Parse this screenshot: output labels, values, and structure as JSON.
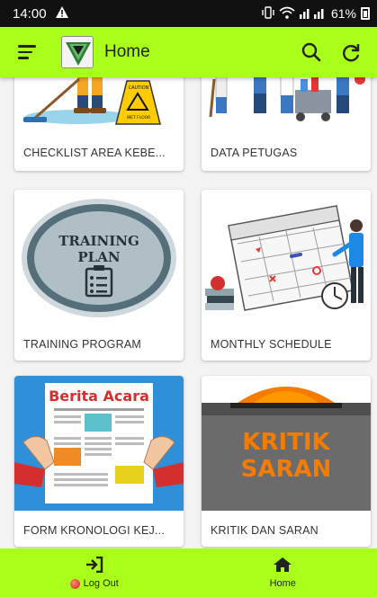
{
  "status_bar": {
    "time": "14:00",
    "battery": "61%",
    "icons": [
      "alert-icon",
      "vibrate-icon",
      "wifi-icon",
      "signal-icon",
      "battery-icon"
    ]
  },
  "app_bar": {
    "title": "Home",
    "actions": [
      "search-icon",
      "refresh-icon"
    ],
    "background": "#aaff1a"
  },
  "cards": [
    {
      "label": "CHECKLIST AREA KEBE...",
      "art": "cleaner-wet-floor"
    },
    {
      "label": "DATA PETUGAS",
      "art": "cleaning-staff"
    },
    {
      "label": "TRAINING PROGRAM",
      "art": "training-plan",
      "art_text": [
        "TRAINING",
        "PLAN"
      ]
    },
    {
      "label": "MONTHLY SCHEDULE",
      "art": "calendar"
    },
    {
      "label": "FORM KRONOLOGI KEJ...",
      "art": "berita-acara",
      "art_text": [
        "Berita Acara"
      ]
    },
    {
      "label": "KRITIK DAN SARAN",
      "art": "kritik-saran",
      "art_text": [
        "KRITIK",
        "SARAN"
      ]
    }
  ],
  "wet_floor_sign": "CAUTION WET FLOOR",
  "bottom_nav": [
    {
      "label": "Log Out",
      "icon": "logout-icon"
    },
    {
      "label": "Home",
      "icon": "home-icon",
      "active": true
    }
  ]
}
